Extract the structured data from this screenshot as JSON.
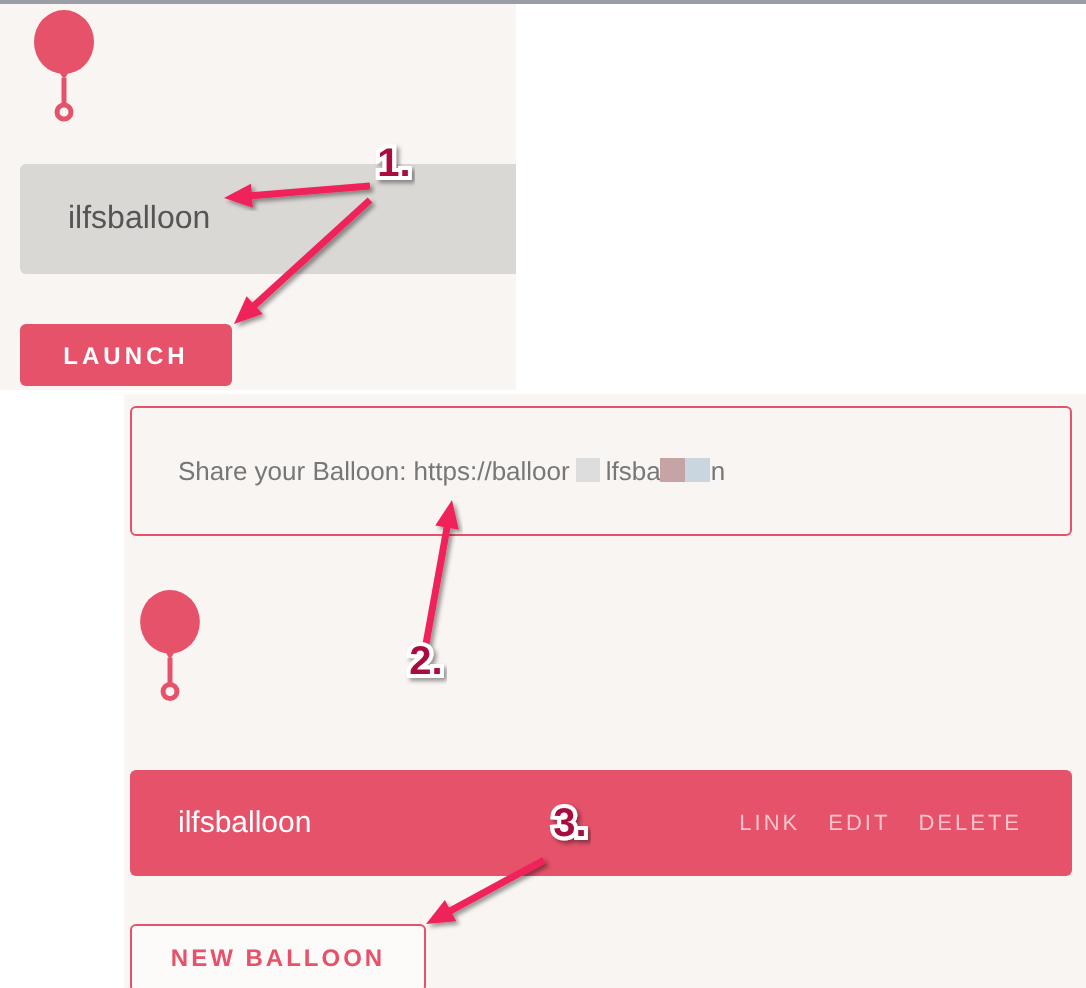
{
  "launcher": {
    "input": {
      "value": "ilfsballoon"
    },
    "button": "LAUNCH"
  },
  "share": {
    "label": "Share your Balloon: https://balloor",
    "parts": [
      "lfsba",
      "n"
    ]
  },
  "balloon": {
    "name": "ilfsballoon",
    "actions": [
      "LINK",
      "EDIT",
      "DELETE"
    ]
  },
  "new_button": "NEW BALLOON",
  "annotations": [
    {
      "label": "1."
    },
    {
      "label": "2."
    },
    {
      "label": "3."
    }
  ]
}
